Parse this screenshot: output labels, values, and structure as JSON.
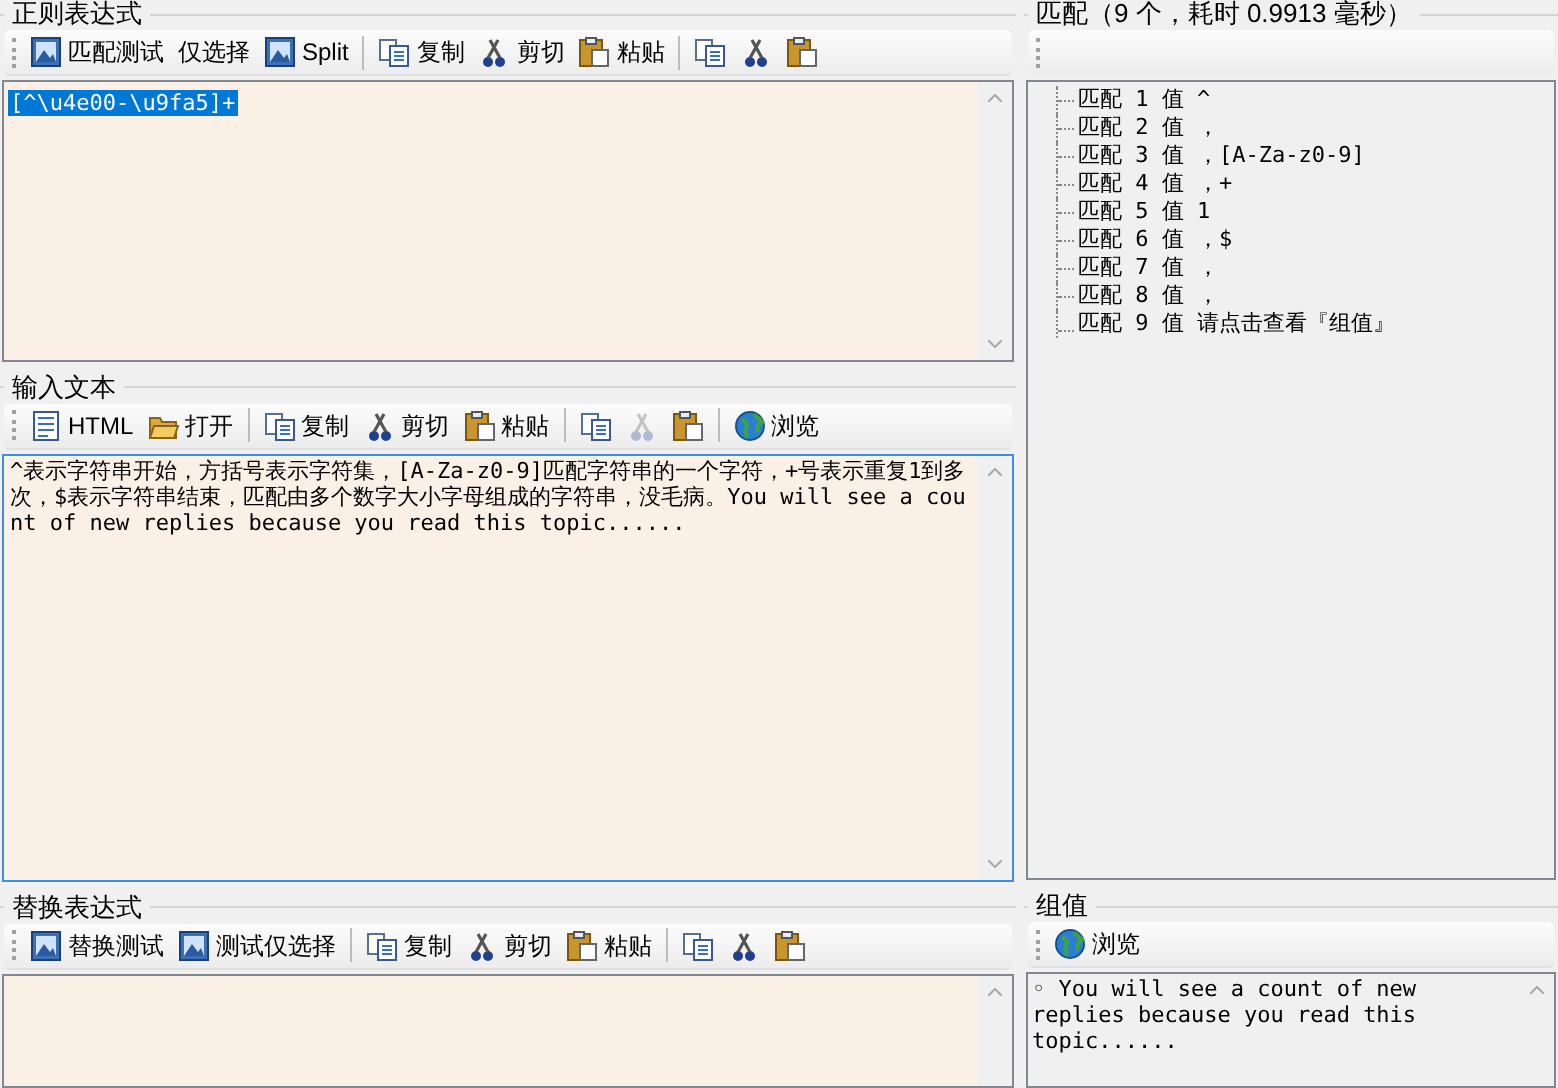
{
  "regex_panel": {
    "title": "正则表达式",
    "toolbar": [
      {
        "kind": "picture",
        "label": "匹配测试",
        "disabled": false
      },
      {
        "kind": "text",
        "label": "仅选择",
        "disabled": false
      },
      {
        "kind": "picture",
        "label": "Split",
        "disabled": false
      },
      {
        "kind": "separator"
      },
      {
        "kind": "copy",
        "label": "复制",
        "disabled": false
      },
      {
        "kind": "cut",
        "label": "剪切",
        "disabled": false
      },
      {
        "kind": "paste",
        "label": "粘贴",
        "disabled": false
      },
      {
        "kind": "separator"
      },
      {
        "kind": "copy",
        "disabled": false
      },
      {
        "kind": "cut",
        "disabled": false
      },
      {
        "kind": "paste",
        "disabled": false
      }
    ],
    "text": {
      "value": "[^\\u4e00-\\u9fa5]+",
      "selected": true
    }
  },
  "input_panel": {
    "title": "输入文本",
    "toolbar": [
      {
        "kind": "html",
        "label": "HTML",
        "disabled": false
      },
      {
        "kind": "open",
        "label": "打开",
        "disabled": false
      },
      {
        "kind": "separator"
      },
      {
        "kind": "copy",
        "label": "复制",
        "disabled": false
      },
      {
        "kind": "cut",
        "label": "剪切",
        "disabled": false
      },
      {
        "kind": "paste",
        "label": "粘贴",
        "disabled": false
      },
      {
        "kind": "separator"
      },
      {
        "kind": "copy",
        "disabled": false
      },
      {
        "kind": "cut",
        "disabled": true
      },
      {
        "kind": "paste",
        "disabled": false
      },
      {
        "kind": "separator"
      },
      {
        "kind": "globe",
        "label": "浏览",
        "disabled": false
      }
    ],
    "text": {
      "value": "^表示字符串开始，方括号表示字符集，[A-Za-z0-9]匹配字符串的一个字符，+号表示重复1到多次，$表示字符串结束，匹配由多个数字大小字母组成的字符串，没毛病。You will see a count of new replies because you read this topic......",
      "selected": false
    }
  },
  "replace_panel": {
    "title": "替换表达式",
    "toolbar": [
      {
        "kind": "picture",
        "label": "替换测试",
        "disabled": false
      },
      {
        "kind": "picture",
        "label": "测试仅选择",
        "disabled": false
      },
      {
        "kind": "separator"
      },
      {
        "kind": "copy",
        "label": "复制",
        "disabled": false
      },
      {
        "kind": "cut",
        "label": "剪切",
        "disabled": false
      },
      {
        "kind": "paste",
        "label": "粘贴",
        "disabled": false
      },
      {
        "kind": "separator"
      },
      {
        "kind": "copy",
        "disabled": false
      },
      {
        "kind": "cut",
        "disabled": false
      },
      {
        "kind": "paste",
        "disabled": false
      }
    ]
  },
  "matches_panel": {
    "title": "匹配（9 个，耗时 0.9913 毫秒）",
    "matches": [
      "匹配 1 值 ^",
      "匹配 2 值 ，",
      "匹配 3 值 ，[A-Za-z0-9]",
      "匹配 4 值 ，+",
      "匹配 5 值 1",
      "匹配 6 值 ，$",
      "匹配 7 值 ，",
      "匹配 8 值 ，",
      "匹配 9 值 请点击查看『组值』"
    ]
  },
  "groups_panel": {
    "title": "组值",
    "toolbar": [
      {
        "kind": "globe",
        "label": "浏览",
        "disabled": false
      }
    ],
    "text": "◦ You will see a count of new replies because you read this topic......"
  }
}
